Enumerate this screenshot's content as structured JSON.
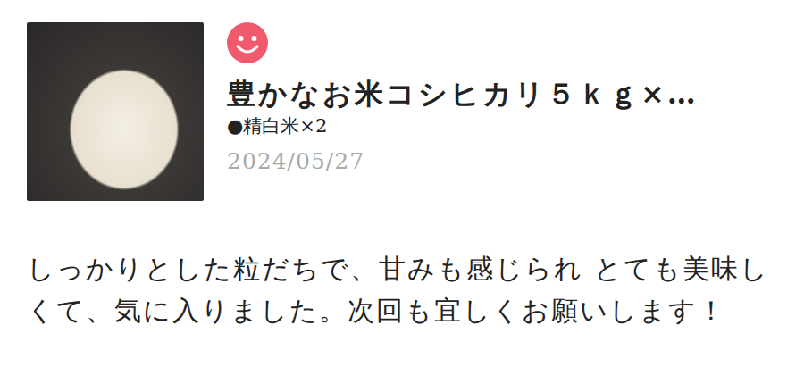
{
  "product": {
    "title": "豊かなお米コシヒカリ５ｋｇ×…",
    "variant": "●精白米×2",
    "date": "2024/05/27"
  },
  "review": {
    "text": "しっかりとした粒だちで、甘みも感じられ とても美味しくて、気に入りました。次回も宜しくお願いします！"
  }
}
